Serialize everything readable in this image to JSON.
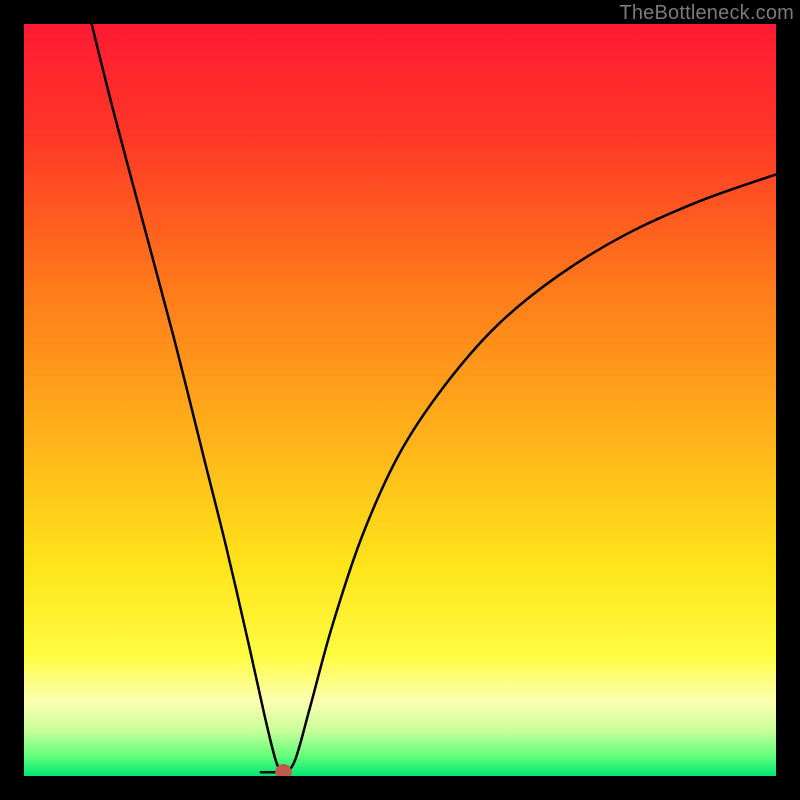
{
  "watermark": "TheBottleneck.com",
  "colors": {
    "background": "#000000",
    "curve": "#000000",
    "marker": "#c1594d",
    "gradient_stops": [
      {
        "offset": 0.0,
        "color": "#ff1a33"
      },
      {
        "offset": 0.15,
        "color": "#ff3727"
      },
      {
        "offset": 0.35,
        "color": "#ff7a1a"
      },
      {
        "offset": 0.55,
        "color": "#ffb21a"
      },
      {
        "offset": 0.72,
        "color": "#ffe41a"
      },
      {
        "offset": 0.84,
        "color": "#fffc42"
      },
      {
        "offset": 0.9,
        "color": "#fcffb0"
      },
      {
        "offset": 0.94,
        "color": "#c8ff9a"
      },
      {
        "offset": 0.975,
        "color": "#5eff7a"
      },
      {
        "offset": 1.0,
        "color": "#00e572"
      }
    ]
  },
  "chart_data": {
    "type": "line",
    "title": "",
    "xlabel": "",
    "ylabel": "",
    "xlim": [
      0,
      100
    ],
    "ylim": [
      0,
      100
    ],
    "series": [
      {
        "name": "bottleneck-curve",
        "x": [
          9,
          12,
          16,
          20,
          24,
          27,
          30,
          32,
          33.5,
          34.5,
          36,
          38,
          41,
          45,
          50,
          56,
          63,
          71,
          80,
          90,
          100
        ],
        "y": [
          100,
          88,
          73,
          58,
          42,
          30,
          17,
          8,
          2,
          0.5,
          2,
          9,
          20,
          32,
          43,
          52,
          60,
          66.5,
          72,
          76.5,
          80
        ]
      }
    ],
    "marker": {
      "x": 34.5,
      "y": 0.5,
      "r": 1.1
    },
    "notch_min": {
      "x_range": [
        31.5,
        34.5
      ],
      "y": 0.5
    }
  }
}
